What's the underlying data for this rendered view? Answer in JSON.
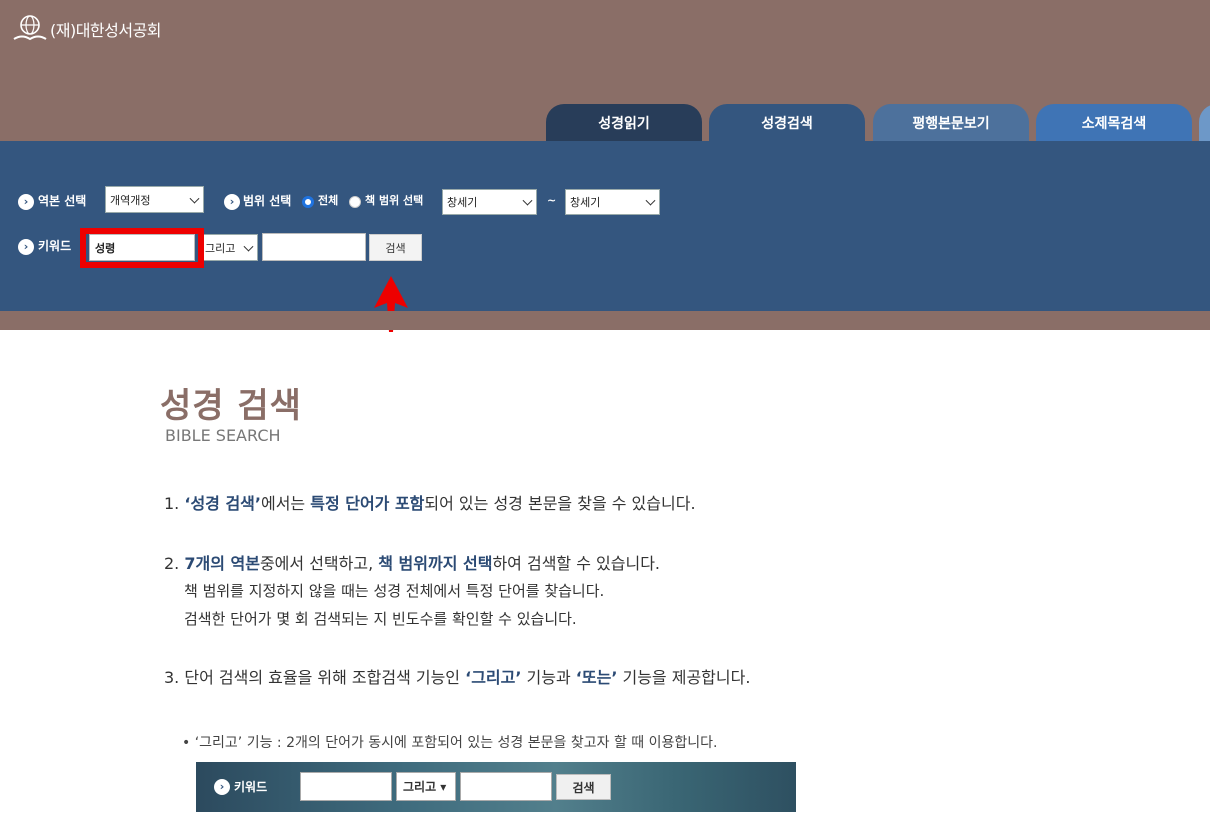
{
  "header": {
    "org_name": "(재)대한성서공회",
    "tabs": [
      "성경읽기",
      "성경검색",
      "평행본문보기",
      "소제목검색"
    ]
  },
  "search_panel": {
    "version_label": "역본 선택",
    "version_value": "개역개정",
    "range_label": "범위 선택",
    "radio_all": "전체",
    "radio_range": "책 범위 선택",
    "book_from": "창세기",
    "tilde": "~",
    "book_to": "창세기",
    "keyword_label": "키워드",
    "keyword_value": "성령",
    "operator_value": "그리고",
    "keyword2_value": "",
    "search_button": "검색"
  },
  "content": {
    "title": "성경 검색",
    "subtitle": "BIBLE SEARCH",
    "item1": {
      "num": "1.",
      "q1": "‘성경 검색’",
      "t1": "에서는 ",
      "b1": "특정 단어가 포함",
      "t2": "되어 있는 성경 본문을 찾을 수 있습니다."
    },
    "item2": {
      "num": "2.",
      "b1": "7개의 역본",
      "t1": "중에서 선택하고, ",
      "b2": "책 범위까지 선택",
      "t2": "하여 검색할 수 있습니다.",
      "line2": "책 범위를 지정하지 않을 때는 성경 전체에서 특정 단어를 찾습니다.",
      "line3": "검색한 단어가 몇 회 검색되는 지 빈도수를 확인할 수 있습니다."
    },
    "item3": {
      "num": "3.",
      "t1": "단어 검색의 효율을 위해 조합검색 기능인 ",
      "b1": "‘그리고’",
      "t2": " 기능과 ",
      "b2": "‘또는’",
      "t3": " 기능을 제공합니다."
    },
    "bullet_note": "• ‘그리고’ 기능 : 2개의 단어가 동시에 포함되어 있는 성경 본문을 찾고자 할 때 이용합니다.",
    "example": {
      "keyword_label": "키워드",
      "operator": "그리고 ▾",
      "button": "검색"
    }
  },
  "colors": {
    "header_brown": "#8a6e67",
    "panel_blue": "#34567f",
    "highlight_red": "#ee0000",
    "accent_navy": "#2b4a74"
  }
}
